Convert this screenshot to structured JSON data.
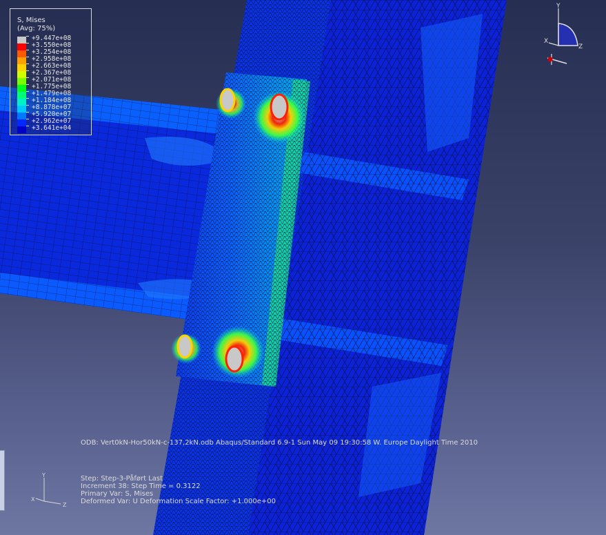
{
  "legend": {
    "title": "S, Mises",
    "subtitle": "(Avg: 75%)",
    "entries": [
      {
        "value": "+9.447e+08",
        "color": "#c8c8c8"
      },
      {
        "value": "+3.550e+08",
        "color": "#ff0000"
      },
      {
        "value": "+3.254e+08",
        "color": "#ff5a00"
      },
      {
        "value": "+2.958e+08",
        "color": "#ffa000"
      },
      {
        "value": "+2.663e+08",
        "color": "#ffd200"
      },
      {
        "value": "+2.367e+08",
        "color": "#d2ff00"
      },
      {
        "value": "+2.071e+08",
        "color": "#78ff00"
      },
      {
        "value": "+1.775e+08",
        "color": "#00ff1e"
      },
      {
        "value": "+1.479e+08",
        "color": "#00ff78"
      },
      {
        "value": "+1.184e+08",
        "color": "#00f0c8"
      },
      {
        "value": "+8.878e+07",
        "color": "#00c8ff"
      },
      {
        "value": "+5.920e+07",
        "color": "#0078ff"
      },
      {
        "value": "+2.962e+07",
        "color": "#0028ff"
      },
      {
        "value": "+3.641e+04",
        "color": "#0000c8"
      }
    ]
  },
  "odb_line": "ODB: Vert0kN-Hor50kN-c-137,2kN.odb    Abaqus/Standard 6.9-1    Sun May 09 19:30:58 W. Europe Daylight Time 2010",
  "step_info": {
    "step": "Step: Step-3-Påført Last",
    "increment": "Increment     38: Step Time =    0.3122",
    "primary_var": "Primary Var: S, Mises",
    "deformed_var": "Deformed Var: U   Deformation Scale Factor: +1.000e+00"
  },
  "triad": {
    "x": "X",
    "y": "Y",
    "z": "Z"
  },
  "colors": {
    "bg_top": "#262e52",
    "bg_bottom": "#6e76a2",
    "mesh_line": "#0a0f2a"
  }
}
